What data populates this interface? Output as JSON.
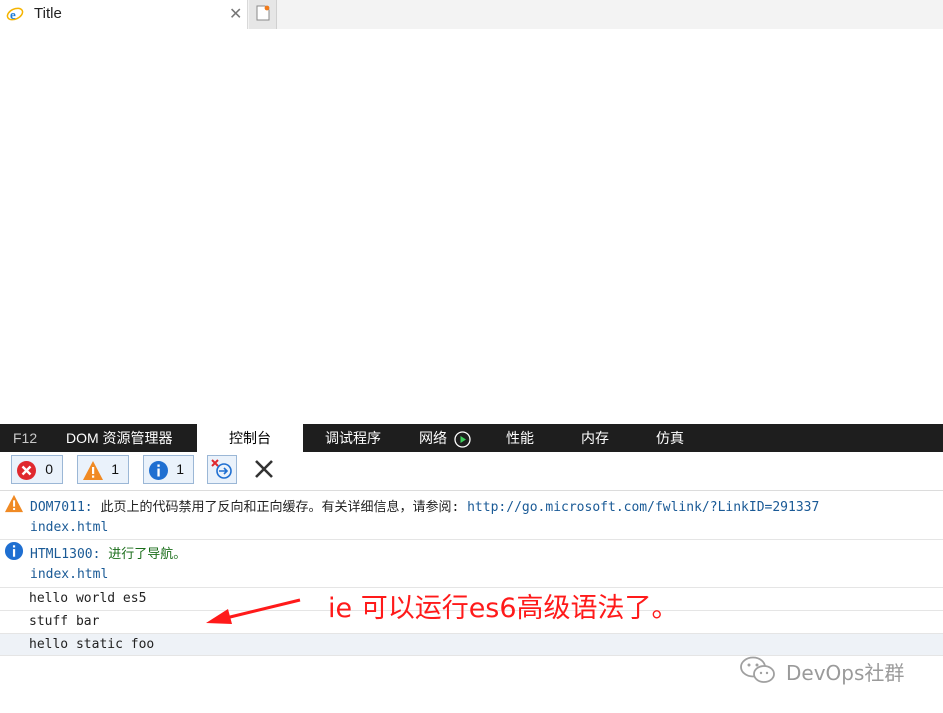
{
  "browser": {
    "tab_title": "Title",
    "close_icon": "close-icon",
    "new_tab_icon": "new-tab-icon"
  },
  "devtools": {
    "tabs": [
      {
        "label": "F12"
      },
      {
        "label": "DOM 资源管理器"
      },
      {
        "label": "控制台",
        "active": true
      },
      {
        "label": "调试程序"
      },
      {
        "label": "网络"
      },
      {
        "label": "性能"
      },
      {
        "label": "内存"
      },
      {
        "label": "仿真"
      }
    ],
    "filters": {
      "errors": "0",
      "warnings": "1",
      "info": "1"
    },
    "colors": {
      "error": "#e0282e",
      "warning": "#f08a24",
      "info": "#1f6fd1",
      "accent": "#1a5a96"
    }
  },
  "console": {
    "warning": {
      "code": "DOM7011:",
      "text": " 此页上的代码禁用了反向和正向缓存。有关详细信息，请参阅: ",
      "url": "http://go.microsoft.com/fwlink/?LinkID=291337",
      "source": "index.html"
    },
    "info": {
      "code": "HTML1300:",
      "text": " 进行了导航。",
      "source": "index.html"
    },
    "logs": [
      "hello world es5",
      "stuff bar",
      "hello static foo"
    ]
  },
  "annotation": {
    "text": "ie 可以运行es6高级语法了。"
  },
  "watermark": {
    "text": "DevOps社群"
  }
}
